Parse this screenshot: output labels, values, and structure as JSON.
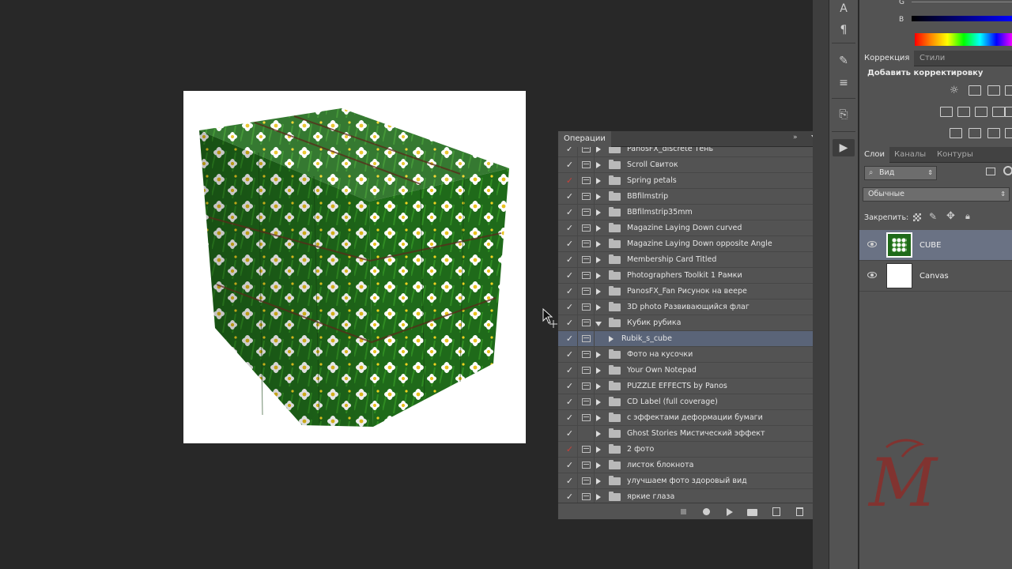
{
  "colors": {
    "workspace": "#282828",
    "panel": "#535353",
    "selection": "#5a6478",
    "layer_selected": "#6a7284",
    "watermark": "#8a2e2a"
  },
  "actions": {
    "tab": "Операции",
    "rows": [
      {
        "name": "PanosFX_discrete Тень",
        "check": "on",
        "expand": "collapsed"
      },
      {
        "name": "Scroll Свиток",
        "check": "on",
        "expand": "collapsed"
      },
      {
        "name": "Spring petals",
        "check": "red",
        "expand": "collapsed"
      },
      {
        "name": "BBfilmstrip",
        "check": "on",
        "expand": "collapsed"
      },
      {
        "name": "BBfilmstrip35mm",
        "check": "on",
        "expand": "collapsed"
      },
      {
        "name": "Magazine Laying Down curved",
        "check": "on",
        "expand": "collapsed"
      },
      {
        "name": "Magazine Laying Down opposite Angle",
        "check": "on",
        "expand": "collapsed"
      },
      {
        "name": "Membership Card Titled",
        "check": "on",
        "expand": "collapsed"
      },
      {
        "name": "Photographers Toolkit 1 Рамки",
        "check": "on",
        "expand": "collapsed"
      },
      {
        "name": "PanosFX_Fan Рисунок на веере",
        "check": "on",
        "expand": "collapsed"
      },
      {
        "name": "3D photo Развивающийся флаг",
        "check": "on",
        "expand": "collapsed"
      },
      {
        "name": "Кубик рубика",
        "check": "on",
        "expand": "expanded"
      },
      {
        "name": "Rubik_s_cube",
        "check": "on",
        "expand": "collapsed",
        "sub": true,
        "selected": true
      },
      {
        "name": "Фото на кусочки",
        "check": "on",
        "expand": "collapsed"
      },
      {
        "name": "Your Own Notepad",
        "check": "on",
        "expand": "collapsed"
      },
      {
        "name": "PUZZLE EFFECTS by Panos",
        "check": "on",
        "expand": "collapsed"
      },
      {
        "name": "CD Label  (full coverage)",
        "check": "on",
        "expand": "collapsed"
      },
      {
        "name": "с эффектами деформации бумаги",
        "check": "on",
        "expand": "collapsed"
      },
      {
        "name": "Ghost Stories Мистический эффект",
        "check": "on",
        "expand": "collapsed",
        "no_dialog": true
      },
      {
        "name": "2 фото",
        "check": "red",
        "expand": "collapsed"
      },
      {
        "name": "листок блокнота",
        "check": "on",
        "expand": "collapsed"
      },
      {
        "name": "улучшаем фото здоровый вид",
        "check": "on",
        "expand": "collapsed"
      },
      {
        "name": "яркие глаза",
        "check": "on",
        "expand": "collapsed"
      }
    ],
    "footer_icons": [
      "stop-icon",
      "record-icon",
      "play-icon",
      "new-set-icon",
      "new-action-icon",
      "trash-icon"
    ]
  },
  "color_panel": {
    "g_label": "G",
    "b_label": "B"
  },
  "correction": {
    "tabs": [
      "Коррекция",
      "Стили"
    ],
    "title": "Добавить корректировку"
  },
  "layers": {
    "tabs": [
      "Слои",
      "Каналы",
      "Контуры"
    ],
    "filter_label": "Вид",
    "blend_mode": "Обычные",
    "lock_label": "Закрепить:",
    "items": [
      {
        "name": "CUBE",
        "selected": true
      },
      {
        "name": "Canvas",
        "selected": false
      }
    ]
  },
  "strip": {
    "text_tool": "A",
    "para_tool": "¶"
  },
  "watermark": {
    "text": "M"
  }
}
